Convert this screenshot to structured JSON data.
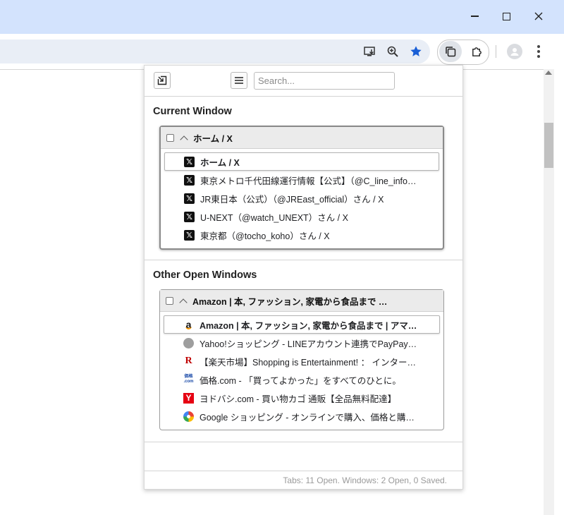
{
  "browser": {
    "window_controls": {
      "minimize": "—",
      "maximize": "☐",
      "close": "✕"
    }
  },
  "popup": {
    "search_placeholder": "Search...",
    "current_window": {
      "heading": "Current Window",
      "window_title": "ホーム / X",
      "tabs": [
        {
          "title": "ホーム / X",
          "favicon": "x-icon",
          "active": true
        },
        {
          "title": "東京メトロ千代田線運行情報【公式】（@C_line_info…",
          "favicon": "x-icon"
        },
        {
          "title": "JR東日本（公式）（@JREast_official）さん / X",
          "favicon": "x-icon"
        },
        {
          "title": "U-NEXT（@watch_UNEXT）さん / X",
          "favicon": "x-icon"
        },
        {
          "title": "東京都（@tocho_koho）さん / X",
          "favicon": "x-icon"
        }
      ]
    },
    "other_windows": {
      "heading": "Other Open Windows",
      "window_title": "Amazon | 本, ファッション, 家電から食品まで …",
      "tabs": [
        {
          "title": "Amazon | 本, ファッション, 家電から食品まで | アマ…",
          "favicon": "amazon-icon",
          "active": true
        },
        {
          "title": "Yahoo!ショッピング - LINEアカウント連携でPayPay…",
          "favicon": "globe-icon"
        },
        {
          "title": "【楽天市場】Shopping is Entertainment! ： インター…",
          "favicon": "rakuten-icon"
        },
        {
          "title": "価格.com - 「買ってよかった」をすべてのひとに。",
          "favicon": "kakaku-icon"
        },
        {
          "title": "ヨドバシ.com - 買い物カゴ 通販【全品無料配達】",
          "favicon": "yodobashi-icon"
        },
        {
          "title": "Google ショッピング - オンラインで購入、価格と購入…",
          "favicon": "google-shopping-icon"
        }
      ]
    },
    "footer": "Tabs: 11 Open. Windows: 2 Open, 0 Saved.",
    "favicons": {
      "x": "𝕏",
      "rakuten": "R",
      "kakaku_top": "価格",
      "kakaku_bottom": ".com",
      "yodobashi": "Y",
      "amazon": "a"
    }
  }
}
